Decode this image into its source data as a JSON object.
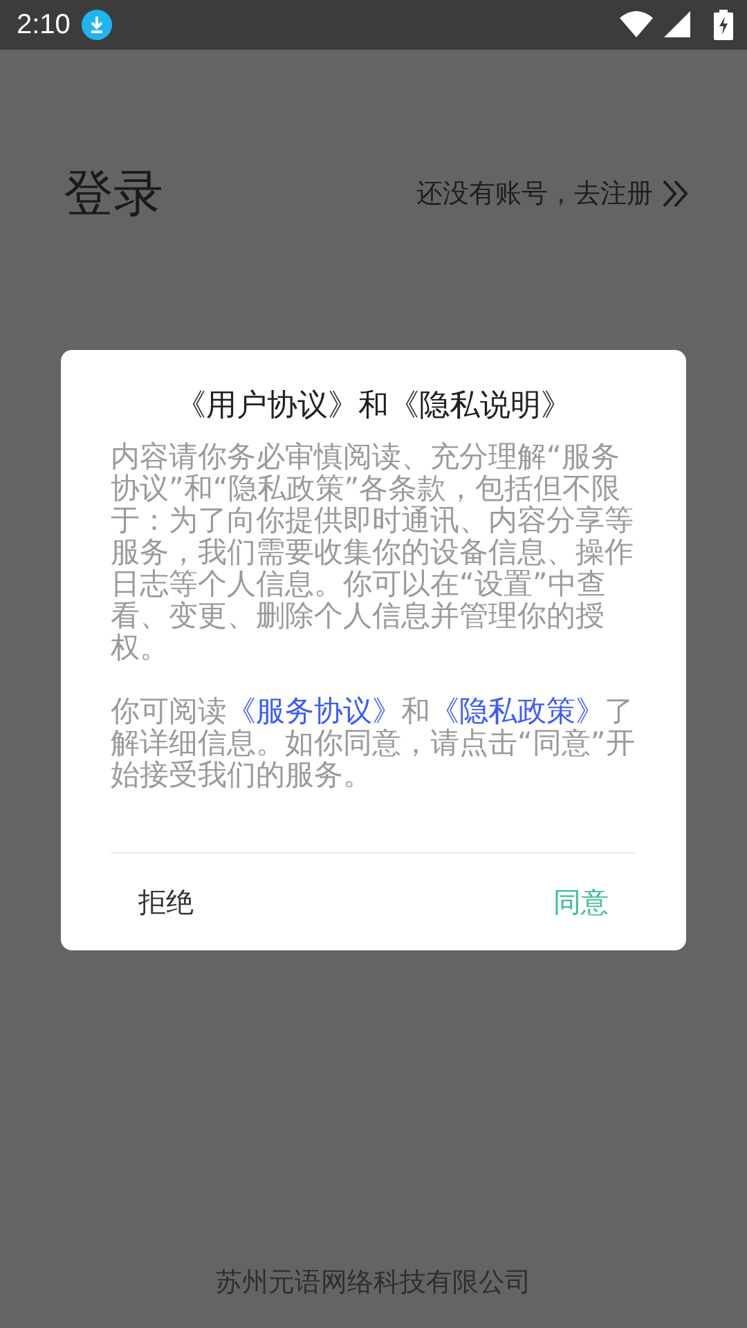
{
  "status_bar": {
    "time": "2:10"
  },
  "header": {
    "title": "登录",
    "register_link": "还没有账号，去注册"
  },
  "dialog": {
    "title": "《用户协议》和《隐私说明》",
    "paragraphs": [
      [
        {
          "kind": "plain",
          "text": "内容请你务必审慎阅读、充分理解“服务协议”和“隐私政策”各条款，包括但不限于：为了向你提供即时通讯、内容分享等服务，我们需要收集你的设备信息、操作日志等个人信息。你可以在“设置”中查看、变更、删除个人信息并管理你的授权。"
        }
      ],
      [
        {
          "kind": "plain",
          "text": "你可阅读"
        },
        {
          "kind": "link",
          "text": "《服务协议》"
        },
        {
          "kind": "plain",
          "text": "和"
        },
        {
          "kind": "link",
          "text": "《隐私政策》"
        },
        {
          "kind": "plain",
          "text": "了解详细信息。如你同意，请点击“同意”开始接受我们的服务。"
        }
      ]
    ],
    "buttons": [
      {
        "kind": "cancel",
        "label": "拒绝"
      },
      {
        "kind": "confirm",
        "label": "同意"
      }
    ]
  },
  "footer": {
    "company": "苏州元语网络科技有限公司"
  }
}
